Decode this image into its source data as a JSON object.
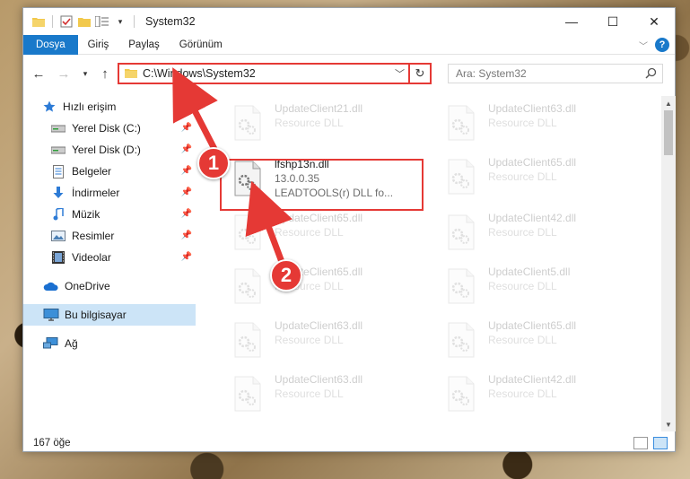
{
  "window": {
    "title": "System32",
    "minimize_glyph": "—",
    "maximize_glyph": "☐",
    "close_glyph": "✕"
  },
  "ribbon": {
    "tabs": [
      "Dosya",
      "Giriş",
      "Paylaş",
      "Görünüm"
    ],
    "accent": "#1979ca"
  },
  "address": {
    "path": "C:\\Windows\\System32",
    "search_placeholder": "Ara: System32"
  },
  "nav": {
    "items": [
      {
        "label": "Hızlı erişim",
        "icon": "star-icon"
      },
      {
        "label": "Yerel Disk (C:)",
        "icon": "drive-icon",
        "pinned": true
      },
      {
        "label": "Yerel Disk (D:)",
        "icon": "drive-icon",
        "pinned": true
      },
      {
        "label": "Belgeler",
        "icon": "documents-icon",
        "pinned": true
      },
      {
        "label": "İndirmeler",
        "icon": "download-icon",
        "pinned": true
      },
      {
        "label": "Müzik",
        "icon": "music-icon",
        "pinned": true
      },
      {
        "label": "Resimler",
        "icon": "pictures-icon",
        "pinned": true
      },
      {
        "label": "Videolar",
        "icon": "video-icon",
        "pinned": true
      },
      {
        "label": "OneDrive",
        "icon": "cloud-icon"
      },
      {
        "label": "Bu bilgisayar",
        "icon": "computer-icon",
        "selected": true
      },
      {
        "label": "Ağ",
        "icon": "network-icon"
      }
    ]
  },
  "files": {
    "left_column": [
      {
        "name": "UpdateClient21.dll",
        "sub": "Resource DLL",
        "faded": true
      },
      {
        "name": "lfshp13n.dll",
        "sub": "13.0.0.35",
        "sub2": "LEADTOOLS(r) DLL fo...",
        "faded": false
      },
      {
        "name": "UpdateClient65.dll",
        "sub": "Resource DLL",
        "faded": true
      },
      {
        "name": "UpdateClient65.dll",
        "sub": "Resource DLL",
        "faded": true
      },
      {
        "name": "UpdateClient63.dll",
        "sub": "Resource DLL",
        "faded": true
      },
      {
        "name": "UpdateClient63.dll",
        "sub": "Resource DLL",
        "faded": true
      }
    ],
    "right_column": [
      {
        "name": "UpdateClient63.dll",
        "sub": "Resource DLL"
      },
      {
        "name": "UpdateClient65.dll",
        "sub": "Resource DLL"
      },
      {
        "name": "UpdateClient42.dll",
        "sub": "Resource DLL"
      },
      {
        "name": "UpdateClient5.dll",
        "sub": "Resource DLL"
      },
      {
        "name": "UpdateClient65.dll",
        "sub": "Resource DLL"
      },
      {
        "name": "UpdateClient42.dll",
        "sub": "Resource DLL"
      }
    ]
  },
  "status": {
    "item_count": "167 öğe"
  },
  "callouts": {
    "step1": "1",
    "step2": "2",
    "color": "#e53935"
  }
}
